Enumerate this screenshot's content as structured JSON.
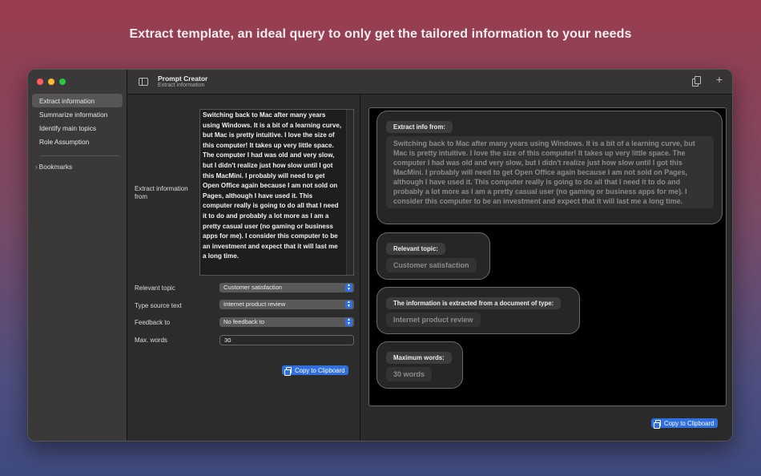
{
  "headline": "Extract template, an ideal query to only get the tailored information to your needs",
  "sidebar": {
    "items": [
      {
        "label": "Extract information"
      },
      {
        "label": "Summarize information"
      },
      {
        "label": "Identify main topics"
      },
      {
        "label": "Role Assumption"
      }
    ],
    "bookmarks_label": "Bookmarks"
  },
  "toolbar": {
    "title": "Prompt Creator",
    "subtitle": "Extract information"
  },
  "form": {
    "text_label": "Extract information from",
    "text_value": "Switching back to Mac after many years using Windows. It is a bit of a learning curve, but Mac is pretty intuitive. I love the size of this computer! It takes up very little space. The computer I had was old and very slow, but I didn't realize just how slow until I got this MacMini. I probably will need to get Open Office again because I am not sold on Pages, although I have used it. This computer really is going to do all that I need it to do and probably a lot more as I am a pretty casual user (no gaming or business apps for me). I consider this computer to be an investment and expect that it will last me a long time.",
    "topic_label": "Relevant topic",
    "topic_value": "Customer satisfaction",
    "source_label": "Type source text",
    "source_value": "Internet product review",
    "feedback_label": "Feedback to",
    "feedback_value": "No feedback to",
    "maxwords_label": "Max. words",
    "maxwords_value": "30",
    "copy_label": "Copy to Clipboard"
  },
  "preview": {
    "extract_title": "Extract info from:",
    "extract_value": "Switching back to Mac after many years using Windows. It is a bit of a learning curve, but Mac is pretty intuitive. I love the size of this computer! It takes up very little space. The computer I had was old and very slow, but I didn't realize just how slow until I got this MacMini. I probably will need to get Open Office again because I am not sold on Pages, although I have used it. This computer really is going to do all that I need it to do and probably a lot more as I am a pretty casual user (no gaming or business apps for me). I consider this computer to be an investment and expect that it will last me a long time.",
    "topic_title": "Relevant topic:",
    "topic_value": "Customer satisfaction",
    "doc_title": "The information is extracted from a document of type:",
    "doc_value": "Internet product review",
    "words_title": "Maximum words:",
    "words_value": "30 words",
    "copy_label": "Copy to Clipboard"
  },
  "colors": {
    "accent": "#2f6fe0",
    "sidebar_bg": "#3a3838",
    "preview_bg": "#000000"
  }
}
